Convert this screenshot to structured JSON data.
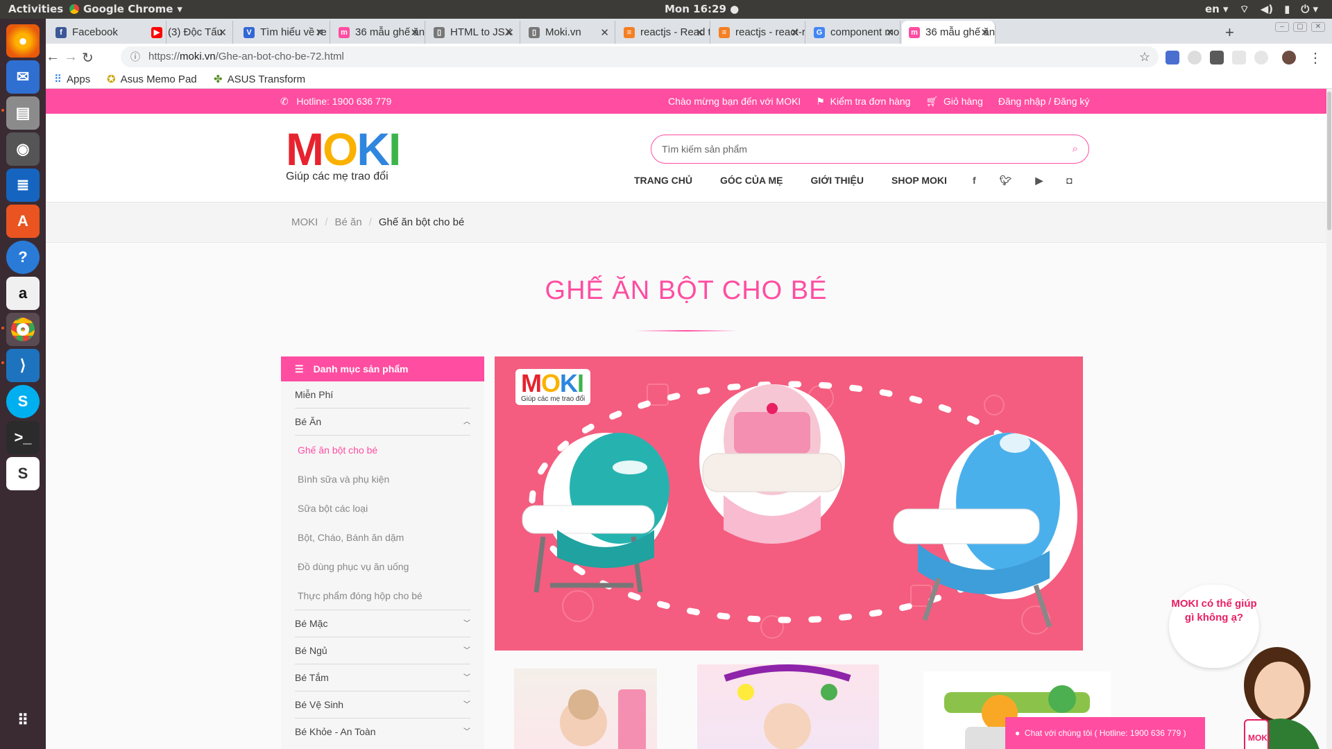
{
  "os": {
    "activities": "Activities",
    "app_name": "Google Chrome",
    "clock": "Mon 16:29",
    "lang": "en"
  },
  "browser": {
    "tabs": [
      {
        "title": "Facebook",
        "icon_color": "#3b5998"
      },
      {
        "title": "(3) Độc Tấu",
        "icon_color": "#ff0000"
      },
      {
        "title": "Tìm hiểu về re",
        "icon_color": "#3367d6"
      },
      {
        "title": "36 mẫu ghế ăn",
        "icon_color": "#ff4da1"
      },
      {
        "title": "HTML to JSX",
        "icon_color": "#777777"
      },
      {
        "title": "Moki.vn",
        "icon_color": "#777777"
      },
      {
        "title": "reactjs - Read t",
        "icon_color": "#f48024"
      },
      {
        "title": "reactjs - react-r",
        "icon_color": "#f48024"
      },
      {
        "title": "component mo",
        "icon_color": "#4285f4"
      },
      {
        "title": "36 mẫu ghế ăn",
        "icon_color": "#ff4da1"
      }
    ],
    "url_scheme": "https://",
    "url_host": "moki.vn",
    "url_path": "/Ghe-an-bot-cho-be-72.html",
    "bookmarks": [
      "Apps",
      "Asus Memo Pad",
      "ASUS Transform"
    ]
  },
  "site": {
    "hotline": "Hotline: 1900 636 779",
    "welcome": "Chào mừng bạn đến với MOKI",
    "check_order": "Kiểm tra đơn hàng",
    "cart": "Giỏ hàng",
    "login": "Đăng nhập / Đăng ký",
    "logo_tagline": "Giúp các mẹ trao đổi",
    "search_placeholder": "Tìm kiếm sản phẩm",
    "nav": [
      "TRANG CHỦ",
      "GÓC CỦA MẸ",
      "GIỚI THIỆU",
      "SHOP MOKI"
    ],
    "breadcrumb": [
      "MOKI",
      "Bé ăn",
      "Ghế ăn bột cho bé"
    ],
    "page_title": "GHẾ ĂN BỘT CHO BÉ",
    "sidebar_title": "Danh mục sản phẩm",
    "categories": [
      {
        "label": "Miễn Phí"
      },
      {
        "label": "Bé Ăn"
      },
      {
        "label": "Bé Mặc"
      },
      {
        "label": "Bé Ngủ"
      },
      {
        "label": "Bé Tắm"
      },
      {
        "label": "Bé Vệ Sinh"
      },
      {
        "label": "Bé Khỏe - An Toàn"
      }
    ],
    "subcategories": [
      "Ghế ăn bột cho bé",
      "Bình sữa và phụ kiện",
      "Sữa bột các loại",
      "Bột, Cháo, Bánh ăn dặm",
      "Đồ dùng phục vụ ăn uống",
      "Thực phẩm đóng hộp cho bé"
    ],
    "helper_bubble": "MOKI có thể giúp gì không ạ?",
    "chat_label": "Chat với chúng tôi ( Hotline: 1900 636 779 )",
    "accent_color": "#ff4da1"
  }
}
